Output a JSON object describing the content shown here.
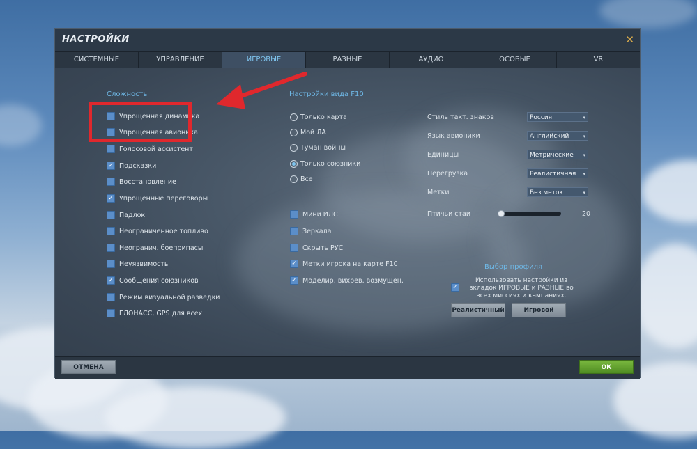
{
  "window": {
    "title": "НАСТРОЙКИ",
    "close_icon": "close-icon"
  },
  "tabs": [
    {
      "label": "СИСТЕМНЫЕ",
      "active": false
    },
    {
      "label": "УПРАВЛЕНИЕ",
      "active": false
    },
    {
      "label": "ИГРОВЫЕ",
      "active": true
    },
    {
      "label": "РАЗНЫЕ",
      "active": false
    },
    {
      "label": "АУДИО",
      "active": false
    },
    {
      "label": "ОСОБЫЕ",
      "active": false
    },
    {
      "label": "VR",
      "active": false
    }
  ],
  "difficulty": {
    "title": "Сложность",
    "items": [
      {
        "label": "Упрощенная динамика",
        "checked": false
      },
      {
        "label": "Упрощенная авионика",
        "checked": false
      },
      {
        "label": "Голосовой ассистент",
        "checked": false
      },
      {
        "label": "Подсказки",
        "checked": true
      },
      {
        "label": "Восстановление",
        "checked": false
      },
      {
        "label": "Упрощенные переговоры",
        "checked": true
      },
      {
        "label": "Падлок",
        "checked": false
      },
      {
        "label": "Неограниченное топливо",
        "checked": false
      },
      {
        "label": "Неогранич. боеприпасы",
        "checked": false
      },
      {
        "label": "Неуязвимость",
        "checked": false
      },
      {
        "label": "Сообщения союзников",
        "checked": true
      },
      {
        "label": "Режим визуальной разведки",
        "checked": false
      },
      {
        "label": "ГЛОНАСС, GPS для всех",
        "checked": false
      }
    ]
  },
  "f10": {
    "title": "Настройки вида F10",
    "radios": [
      {
        "label": "Только карта",
        "selected": false
      },
      {
        "label": "Мой ЛА",
        "selected": false
      },
      {
        "label": "Туман войны",
        "selected": false
      },
      {
        "label": "Только союзники",
        "selected": true
      },
      {
        "label": "Все",
        "selected": false
      }
    ],
    "checkboxes": [
      {
        "label": "Мини ИЛС",
        "checked": false
      },
      {
        "label": "Зеркала",
        "checked": false
      },
      {
        "label": "Скрыть РУС",
        "checked": false
      },
      {
        "label": "Метки игрока на карте F10",
        "checked": true
      },
      {
        "label": "Моделир. вихрев. возмущен.",
        "checked": true
      }
    ]
  },
  "options": [
    {
      "label": "Стиль такт. знаков",
      "value": "Россия"
    },
    {
      "label": "Язык авионики",
      "value": "Английский"
    },
    {
      "label": "Единицы",
      "value": "Метрические"
    },
    {
      "label": "Перегрузка",
      "value": "Реалистичная"
    },
    {
      "label": "Метки",
      "value": "Без меток"
    }
  ],
  "birds": {
    "label": "Птичьи стаи",
    "value": "20",
    "level": 0
  },
  "profile": {
    "title": "Выбор профиля",
    "checkbox_label": "Использовать настройки из вкладок ИГРОВЫЕ и РАЗНЫЕ во всех миссиях и кампаниях.",
    "checked": true,
    "realistic_button": "Реалистичный",
    "game_button": "Игровой"
  },
  "footer": {
    "cancel": "ОТМЕНА",
    "ok": "ОК"
  },
  "colors": {
    "accent": "#6fb8e6",
    "checkbox": "#5b8ec9",
    "ok_button": "#5fa02e",
    "annotation": "#e0282d"
  }
}
